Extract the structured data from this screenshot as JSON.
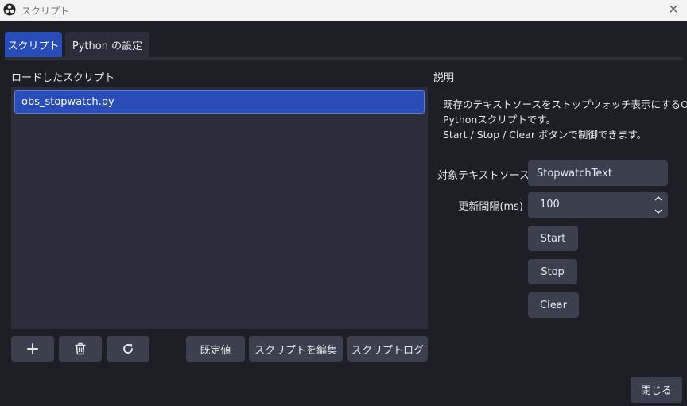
{
  "window": {
    "title": "スクリプト"
  },
  "tabs": [
    {
      "label": "スクリプト",
      "active": true
    },
    {
      "label": "Python の設定",
      "active": false
    }
  ],
  "loaded_scripts": {
    "label": "ロードしたスクリプト",
    "items": [
      "obs_stopwatch.py"
    ],
    "selected": "obs_stopwatch.py"
  },
  "list_toolbar": {
    "add_icon": "plus-icon",
    "remove_icon": "trash-icon",
    "reload_icon": "refresh-icon",
    "defaults_label": "既定値",
    "edit_label": "スクリプトを編集",
    "log_label": "スクリプトログ"
  },
  "description": {
    "label": "説明",
    "lines": [
      "既存のテキストソースをストップウォッチ表示にするOBS",
      "Pythonスクリプトです。",
      "Start / Stop / Clear ボタンで制御できます。"
    ]
  },
  "properties": {
    "source_name_label": "対象テキストソース名",
    "source_name_value": "StopwatchText",
    "interval_label": "更新間隔(ms)",
    "interval_value": "100",
    "start_label": "Start",
    "stop_label": "Stop",
    "clear_label": "Clear"
  },
  "footer": {
    "close_label": "閉じる"
  },
  "colors": {
    "background": "#1d1e26",
    "panel": "#2b2d38",
    "accent": "#284cb8",
    "button": "#3c404e"
  }
}
